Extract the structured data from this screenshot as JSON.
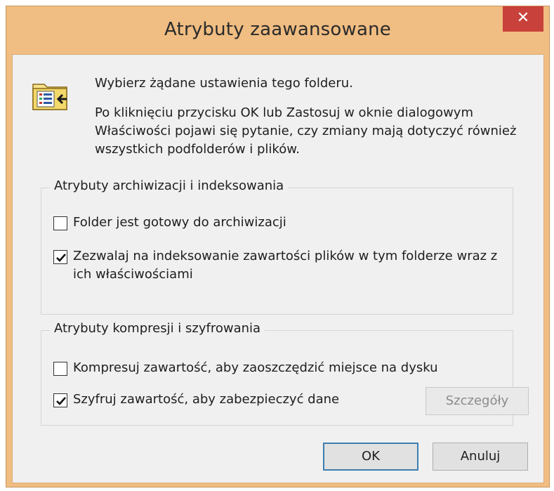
{
  "window": {
    "title": "Atrybuty zaawansowane",
    "close_glyph": "✕",
    "frame_color": "#f0bd82",
    "close_color": "#c8413a"
  },
  "intro": {
    "line1": "Wybierz żądane ustawienia tego folderu.",
    "line2": "Po kliknięciu przycisku OK lub Zastosuj w oknie dialogowym Właściwości pojawi się pytanie, czy zmiany mają dotyczyć również wszystkich podfolderów i plików.",
    "icon": "folder-properties-icon"
  },
  "archive_group": {
    "title": "Atrybuty archiwizacji i indeksowania",
    "items": [
      {
        "label": "Folder jest gotowy do archiwizacji",
        "checked": false
      },
      {
        "label": "Zezwalaj na indeksowanie zawartości plików w tym folderze wraz z ich właściwościami",
        "checked": true
      }
    ]
  },
  "compression_group": {
    "title": "Atrybuty kompresji i szyfrowania",
    "items": [
      {
        "label": "Kompresuj zawartość, aby zaoszczędzić miejsce na dysku",
        "checked": false
      },
      {
        "label": "Szyfruj zawartość, aby zabezpieczyć dane",
        "checked": true
      }
    ],
    "details_button": "Szczegóły"
  },
  "buttons": {
    "ok": "OK",
    "cancel": "Anuluj"
  }
}
